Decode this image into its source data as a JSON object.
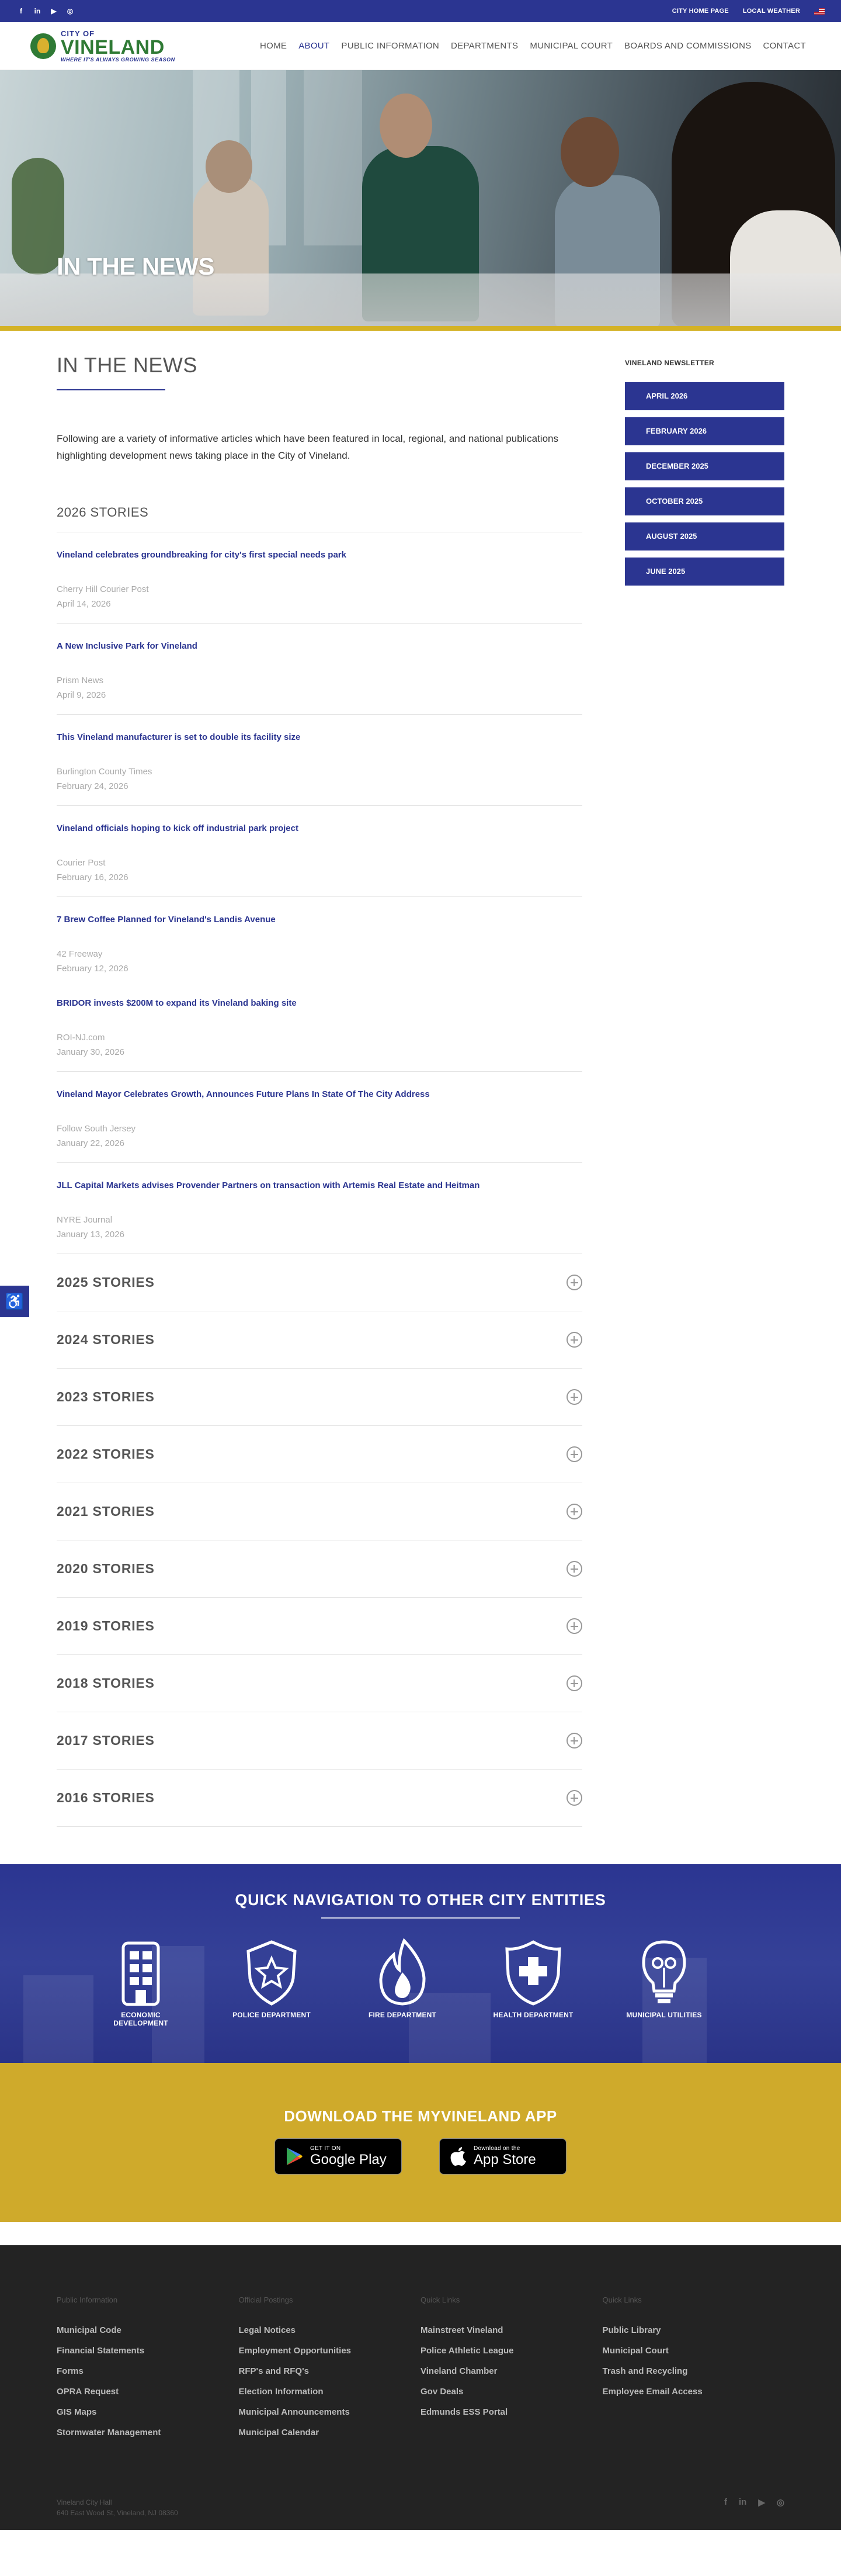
{
  "topbar": {
    "social": [
      {
        "icon": "facebook-icon",
        "glyph": "f"
      },
      {
        "icon": "linkedin-icon",
        "glyph": "in"
      },
      {
        "icon": "youtube-icon",
        "glyph": "▶"
      },
      {
        "icon": "instagram-icon",
        "glyph": "◎"
      }
    ],
    "links": [
      "CITY HOME PAGE",
      "LOCAL WEATHER"
    ]
  },
  "logo": {
    "city": "CITY OF",
    "name": "VINELAND",
    "tagline": "WHERE IT'S ALWAYS GROWING SEASON"
  },
  "nav": [
    "HOME",
    "ABOUT",
    "PUBLIC INFORMATION",
    "DEPARTMENTS",
    "MUNICIPAL COURT",
    "BOARDS AND COMMISSIONS",
    "CONTACT"
  ],
  "nav_active": "ABOUT",
  "hero": {
    "title": "IN THE NEWS"
  },
  "page": {
    "title": "IN THE NEWS",
    "intro": "Following are a variety of informative articles which have been featured in local, regional, and national publications highlighting development news taking place in the City of Vineland."
  },
  "current_section": "2026 STORIES",
  "stories": [
    {
      "title": "Vineland celebrates groundbreaking for city's first special needs park",
      "source": "Cherry Hill Courier Post",
      "date": "April 14, 2026"
    },
    {
      "title": "A New Inclusive Park for Vineland",
      "source": "Prism News",
      "date": "April 9, 2026"
    },
    {
      "title": "This Vineland manufacturer is set to double its facility size",
      "source": "Burlington County Times",
      "date": "February 24, 2026"
    },
    {
      "title": "Vineland officials hoping to kick off industrial park project",
      "source": "Courier Post",
      "date": "February 16, 2026"
    },
    {
      "title": "7 Brew Coffee Planned for Vineland's Landis Avenue",
      "source": "42 Freeway",
      "date": "February 12, 2026"
    },
    {
      "title": "BRIDOR invests $200M to expand its Vineland baking site",
      "source": "ROI-NJ.com",
      "date": "January 30, 2026"
    },
    {
      "title": "Vineland Mayor Celebrates Growth, Announces Future Plans In State Of The City Address",
      "source": "Follow South Jersey",
      "date": "January 22, 2026"
    },
    {
      "title": "JLL Capital Markets advises Provender Partners on transaction with Artemis Real Estate and Heitman",
      "source": "NYRE Journal",
      "date": "January 13, 2026"
    }
  ],
  "archive": [
    "2025 STORIES",
    "2024 STORIES",
    "2023 STORIES",
    "2022 STORIES",
    "2021 STORIES",
    "2020 STORIES",
    "2019 STORIES",
    "2018 STORIES",
    "2017 STORIES",
    "2016 STORIES"
  ],
  "sidebar": {
    "heading": "VINELAND NEWSLETTER",
    "buttons": [
      "APRIL 2026",
      "FEBRUARY 2026",
      "DECEMBER 2025",
      "OCTOBER 2025",
      "AUGUST 2025",
      "JUNE 2025"
    ]
  },
  "quicknav": {
    "title": "QUICK NAVIGATION TO OTHER CITY ENTITIES",
    "items": [
      {
        "label": "ECONOMIC DEVELOPMENT",
        "icon": "building-icon"
      },
      {
        "label": "POLICE DEPARTMENT",
        "icon": "police-badge-icon"
      },
      {
        "label": "FIRE DEPARTMENT",
        "icon": "flame-icon"
      },
      {
        "label": "HEALTH DEPARTMENT",
        "icon": "health-shield-icon"
      },
      {
        "label": "MUNICIPAL UTILITIES",
        "icon": "lightbulb-icon"
      }
    ]
  },
  "app": {
    "title": "DOWNLOAD THE MYVINELAND APP",
    "google": {
      "small": "GET IT ON",
      "big": "Google Play"
    },
    "apple": {
      "small": "Download on the",
      "big": "App Store"
    }
  },
  "footer": {
    "columns": [
      {
        "heading": "Public Information",
        "links": [
          "Municipal Code",
          "Financial Statements",
          "Forms",
          "OPRA Request",
          "GIS Maps",
          "Stormwater Management"
        ]
      },
      {
        "heading": "Official Postings",
        "links": [
          "Legal Notices",
          "Employment Opportunities",
          "RFP's and RFQ's",
          "Election Information",
          "Municipal Announcements",
          "Municipal Calendar"
        ]
      },
      {
        "heading": "Quick Links",
        "links": [
          "Mainstreet Vineland",
          "Police Athletic League",
          "Vineland Chamber",
          "Gov Deals",
          "Edmunds ESS Portal"
        ]
      },
      {
        "heading": "Quick Links",
        "links": [
          "Public Library",
          "Municipal Court",
          "Trash and Recycling",
          "Employee Email Access"
        ]
      }
    ],
    "address_line1": "Vineland City Hall",
    "address_line2": "640 East Wood St, Vineland, NJ 08360",
    "social": [
      {
        "icon": "facebook-icon",
        "glyph": "f"
      },
      {
        "icon": "linkedin-icon",
        "glyph": "in"
      },
      {
        "icon": "youtube-icon",
        "glyph": "▶"
      },
      {
        "icon": "instagram-icon",
        "glyph": "◎"
      }
    ]
  },
  "colors": {
    "brand_blue": "#2b3591",
    "brand_green": "#2f7a35",
    "gold": "#cfaa2b",
    "footer_bg": "#232323"
  }
}
